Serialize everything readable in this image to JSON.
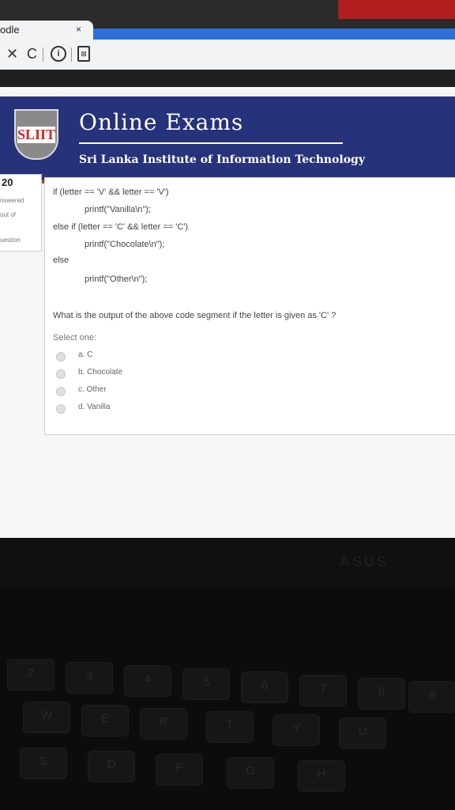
{
  "browser": {
    "tab_title": "odle",
    "tab_close": "×",
    "toolbar": {
      "stop": "✕",
      "reload": "C",
      "info": "i",
      "page": "⊠"
    }
  },
  "header": {
    "logo_text": "SLIIT",
    "title": "Online Exams",
    "subtitle": "Sri Lanka Institute of Information Technology"
  },
  "quiz_nav": {
    "number": "20",
    "lines": [
      "nswered",
      "out of",
      "uestion"
    ]
  },
  "question": {
    "code_lines": [
      "if (letter == 'V' && letter == 'V')",
      "printf(\"Vanilla\\n\");",
      "else if (letter == 'C' && letter == 'C')",
      "printf(\"Chocolate\\n\");",
      "else",
      "printf(\"Other\\n\");"
    ],
    "prompt": "What is the output of the above code segment if the letter is given as 'C' ?",
    "select_label": "Select one:",
    "options": [
      "a. C",
      "b. Chocolate",
      "c. Other",
      "d. Vanilla"
    ]
  },
  "laptop": {
    "brand": "ASUS",
    "keys": [
      "2",
      "3",
      "4",
      "5",
      "6",
      "7",
      "8",
      "9",
      "W",
      "E",
      "R",
      "T",
      "Y",
      "U",
      "S",
      "D",
      "F",
      "G",
      "H"
    ]
  }
}
